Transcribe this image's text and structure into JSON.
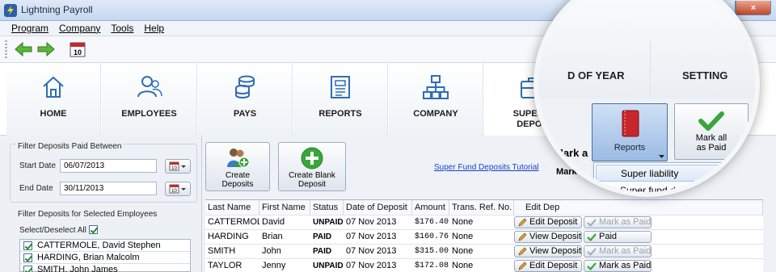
{
  "window": {
    "title": "Lightning Payroll",
    "controls": [
      "_",
      "□",
      "×"
    ]
  },
  "menu": [
    "Program",
    "Company",
    "Tools",
    "Help"
  ],
  "toolbar": {
    "calendar_day": "10"
  },
  "nav": [
    {
      "key": "home",
      "label": "HOME"
    },
    {
      "key": "employees",
      "label": "EMPLOYEES"
    },
    {
      "key": "pays",
      "label": "PAYS"
    },
    {
      "key": "reports",
      "label": "REPORTS"
    },
    {
      "key": "company",
      "label": "COMPANY"
    },
    {
      "key": "super",
      "label": "SUPER F",
      "label2": "DEPOS"
    }
  ],
  "filter": {
    "title": "Filter Deposits Paid Between",
    "start_label": "Start Date",
    "start_value": "06/07/2013",
    "end_label": "End Date",
    "end_value": "30/11/2013",
    "cal_day": "10"
  },
  "employees_filter": {
    "title": "Filter Deposits for Selected Employees",
    "select_all": "Select/Deselect All",
    "items": [
      "CATTERMOLE, David Stephen",
      "HARDING, Brian Malcolm",
      "SMITH, John James"
    ]
  },
  "actions": {
    "create_deposits": [
      "Create",
      "Deposits"
    ],
    "create_blank": [
      "Create Blank",
      "Deposit"
    ],
    "tutorial": "Super Fund Deposits Tutorial",
    "mark_as": "Mark as"
  },
  "grid": {
    "columns": [
      "Last Name",
      "First Name",
      "Status",
      "Date of Deposit",
      "Amount",
      "Trans. Ref. No.",
      "Edit Dep"
    ],
    "rows": [
      {
        "last": "CATTERMOLE",
        "first": "David",
        "status": "UNPAID",
        "date": "07 Nov 2013",
        "amount": "$176.40",
        "ref": "None",
        "edit": "Edit Deposit",
        "mark": "Mark as Paid",
        "mark_enabled": false
      },
      {
        "last": "HARDING",
        "first": "Brian",
        "status": "PAID",
        "date": "07 Nov 2013",
        "amount": "$160.76",
        "ref": "None",
        "edit": "View Deposit",
        "mark": "Paid",
        "mark_enabled": true
      },
      {
        "last": "SMITH",
        "first": "John",
        "status": "PAID",
        "date": "07 Nov 2013",
        "amount": "$315.00",
        "ref": "None",
        "edit": "View Deposit",
        "mark": "Mark as Paid",
        "mark_enabled": false
      },
      {
        "last": "TAYLOR",
        "first": "Jenny",
        "status": "UNPAID",
        "date": "07 Nov 2013",
        "amount": "$172.08",
        "ref": "None",
        "edit": "Edit Deposit",
        "mark": "Mark as Paid",
        "mark_enabled": true
      }
    ]
  },
  "magnifier": {
    "tab_end_of_year": "D OF YEAR",
    "tab_settings": "SETTING",
    "reports_button": "Reports",
    "mark_all": [
      "Mark all",
      "as Paid"
    ],
    "menu_items": [
      "Super liability",
      "Super fund deposits"
    ],
    "frag_mark": "Mark a",
    "frag_mark2": "Mar"
  },
  "colors": {
    "accent": "#2f6db5",
    "green": "#3aa53a",
    "red_book": "#c8262c"
  }
}
